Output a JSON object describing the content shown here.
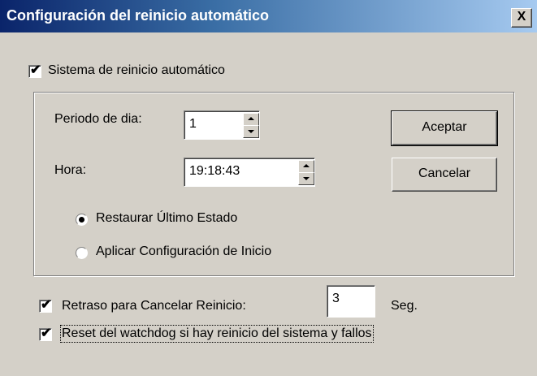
{
  "dialog": {
    "title": "Configuración del reinicio automático",
    "close_label": "X"
  },
  "auto_restart": {
    "label": "Sistema de reinicio automático",
    "checked": true
  },
  "period": {
    "label": "Periodo de dia:",
    "value": "1"
  },
  "hour": {
    "label": "Hora:",
    "value": "19:18:43"
  },
  "buttons": {
    "accept": "Aceptar",
    "cancel": "Cancelar"
  },
  "radios": [
    {
      "label": "Restaurar Último Estado",
      "selected": true
    },
    {
      "label": "Aplicar Configuración de Inicio",
      "selected": false
    }
  ],
  "delay": {
    "label": "Retraso para Cancelar Reinicio:",
    "value": "3",
    "unit": "Seg.",
    "checked": true
  },
  "watchdog": {
    "label": "Reset del watchdog si hay reinicio del sistema y fallos",
    "checked": true
  },
  "colors": {
    "title_start": "#0a246a",
    "title_end": "#a6caf0",
    "face": "#d4d0c8"
  }
}
